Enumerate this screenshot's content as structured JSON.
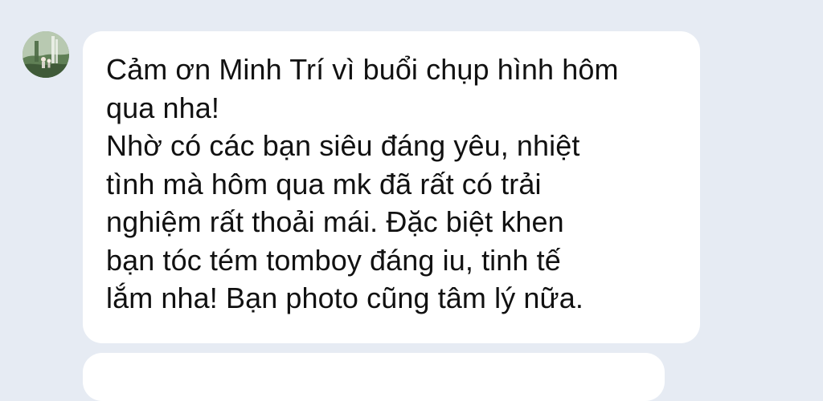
{
  "conversation": {
    "messages": [
      {
        "sender": "other",
        "avatar_icon": "user-avatar-photo",
        "text": "Cảm ơn Minh Trí vì buổi chụp hình hôm\nqua nha!\nNhờ có các bạn siêu đáng yêu, nhiệt\ntình mà hôm qua mk đã rất có trải\nnghiệm rất thoải mái. Đặc biệt khen\nbạn tóc tém tomboy đáng iu, tinh tế\nlắm nha! Bạn photo cũng tâm lý nữa."
      }
    ]
  },
  "colors": {
    "background": "#e6ebf3",
    "bubble": "#ffffff",
    "text": "#111111"
  }
}
